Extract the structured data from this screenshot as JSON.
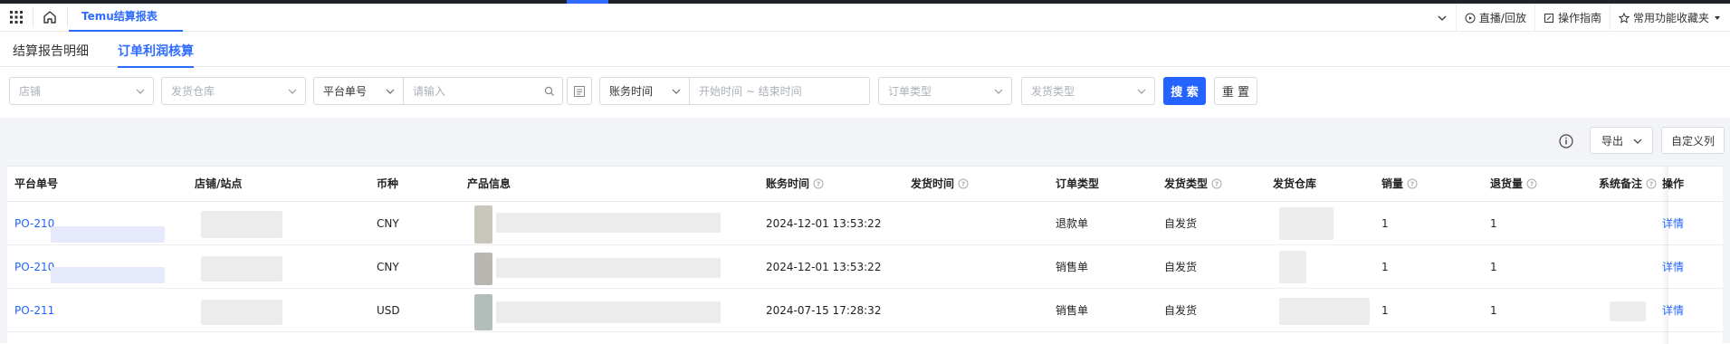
{
  "tabbar": {
    "active_tab": "Temu结算报表",
    "tools": [
      {
        "label": "直播/回放",
        "icon": "play-circle-icon"
      },
      {
        "label": "操作指南",
        "icon": "edit-doc-icon"
      },
      {
        "label": "常用功能收藏夹",
        "icon": "star-icon"
      }
    ]
  },
  "subtabs": [
    "结算报告明细",
    "订单利润核算"
  ],
  "filters": {
    "store_placeholder": "店铺",
    "warehouse_placeholder": "发货仓库",
    "order_no_select": "平台单号",
    "order_no_placeholder": "请输入",
    "time_select": "账务时间",
    "time_placeholder": "开始时间 ~ 结束时间",
    "order_type_placeholder": "订单类型",
    "ship_type_placeholder": "发货类型",
    "search": "搜 索",
    "reset": "重 置"
  },
  "toolbar": {
    "export": "导出",
    "custom_columns": "自定义列"
  },
  "table": {
    "headers": [
      "平台单号",
      "店铺/站点",
      "币种",
      "产品信息",
      "账务时间",
      "发货时间",
      "订单类型",
      "发货类型",
      "发货仓库",
      "销量",
      "退货量",
      "系统备注",
      "操作"
    ],
    "rows": [
      {
        "order_no": "PO-210",
        "currency": "CNY",
        "time": "2024-12-01 13:53:22",
        "order_type": "退款单",
        "ship_type": "自发货",
        "qty": "1",
        "returns": "1",
        "action": "详情"
      },
      {
        "order_no": "PO-210",
        "currency": "CNY",
        "time": "2024-12-01 13:53:22",
        "order_type": "销售单",
        "ship_type": "自发货",
        "qty": "1",
        "returns": "1",
        "action": "详情"
      },
      {
        "order_no": "PO-211",
        "currency": "USD",
        "time": "2024-07-15 17:28:32",
        "order_type": "销售单",
        "ship_type": "自发货",
        "qty": "1",
        "returns": "1",
        "action": "详情"
      }
    ]
  },
  "colors": {
    "accent": "#2463ff",
    "topbar": "#1f2229"
  }
}
